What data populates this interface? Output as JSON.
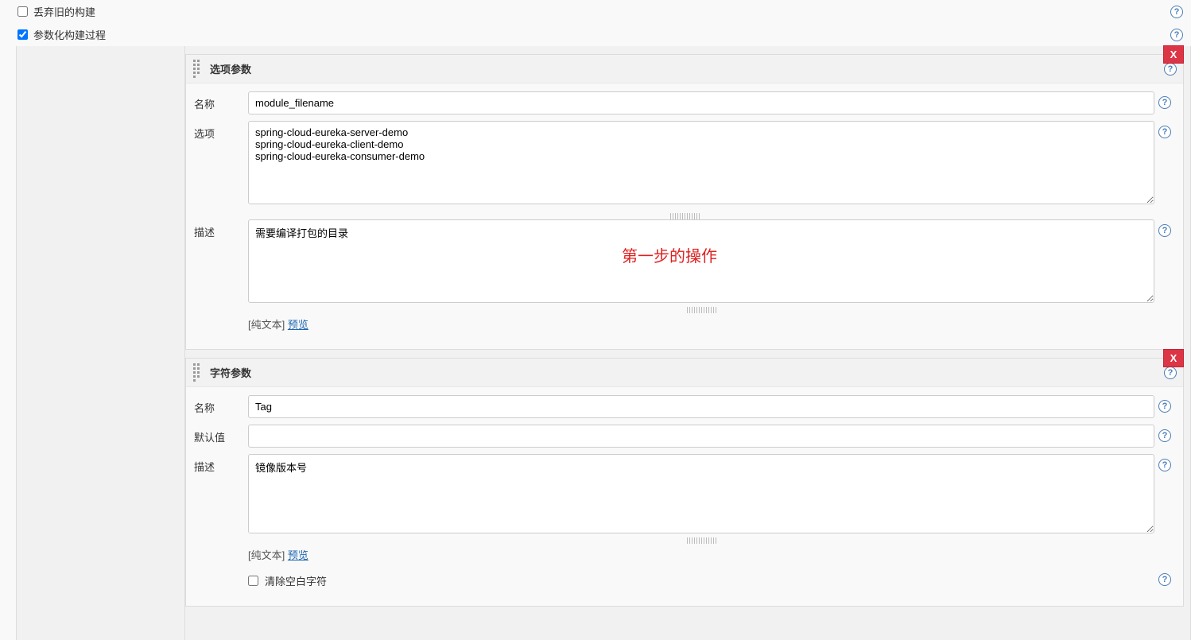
{
  "topChecks": {
    "discard": {
      "label": "丢弃旧的构建",
      "checked": false
    },
    "parameterized": {
      "label": "参数化构建过程",
      "checked": true
    }
  },
  "param1": {
    "header": "选项参数",
    "name": {
      "label": "名称",
      "value": "module_filename"
    },
    "options": {
      "label": "选项",
      "value": "spring-cloud-eureka-server-demo\nspring-cloud-eureka-client-demo\nspring-cloud-eureka-consumer-demo"
    },
    "desc": {
      "label": "描述",
      "value": "需要编译打包的目录"
    },
    "plainText": "[纯文本]",
    "previewLink": "预览"
  },
  "param2": {
    "header": "字符参数",
    "name": {
      "label": "名称",
      "value": "Tag"
    },
    "default": {
      "label": "默认值",
      "value": ""
    },
    "desc": {
      "label": "描述",
      "value": "镜像版本号"
    },
    "plainText": "[纯文本]",
    "previewLink": "预览",
    "trim": {
      "label": "清除空白字符",
      "checked": false
    }
  },
  "closeLabel": "X",
  "annotation": "第一步的操作",
  "helpGlyph": "?"
}
